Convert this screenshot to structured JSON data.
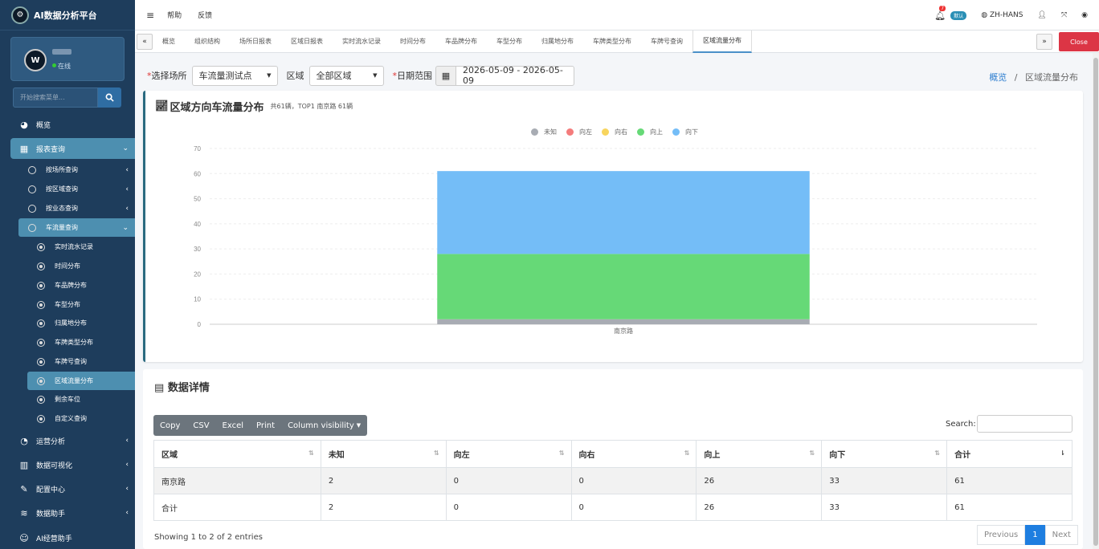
{
  "brand": {
    "title": "AI数据分析平台"
  },
  "user": {
    "status": "在线"
  },
  "sidebar_search": {
    "placeholder": "开始搜索菜单..."
  },
  "nav": {
    "overview": "概览",
    "reports": "报表查询",
    "by_venue": "按场所查询",
    "by_region": "按区域查询",
    "by_business": "按业态查询",
    "traffic": "车流量查询",
    "traffic_items": [
      "实时流水记录",
      "时间分布",
      "车品牌分布",
      "车型分布",
      "归属地分布",
      "车牌类型分布",
      "车牌号查询",
      "区域流量分布",
      "剩余车位",
      "自定义查询"
    ],
    "operations": "运营分析",
    "visualization": "数据可视化",
    "config": "配置中心",
    "assistant": "数据助手",
    "ai_assistant": "AI经营助手"
  },
  "topbar": {
    "help": "帮助",
    "feedback": "反馈",
    "notif_count": "7",
    "default_badge": "默认",
    "language": "ZH-HANS"
  },
  "tabs": [
    "概览",
    "组织结构",
    "场所日报表",
    "区域日报表",
    "实时流水记录",
    "时间分布",
    "车品牌分布",
    "车型分布",
    "归属地分布",
    "车牌类型分布",
    "车牌号查询",
    "区域流量分布"
  ],
  "close_label": "Close",
  "filters": {
    "venue_label": "选择场所",
    "venue_value": "车流量测试点",
    "region_label": "区域",
    "region_value": "全部区域",
    "date_label": "日期范围",
    "date_value": "2026-05-09 - 2026-05-09"
  },
  "breadcrumb": {
    "home": "概览",
    "sep": "/",
    "current": "区域流量分布"
  },
  "chart_header": {
    "title": "区域方向车流量分布",
    "subtitle": "共61辆，TOP1 南京路 61辆"
  },
  "chart_data": {
    "type": "bar",
    "stacked": true,
    "categories": [
      "南京路"
    ],
    "series": [
      {
        "name": "未知",
        "values": [
          2
        ],
        "color": "#a8acb3"
      },
      {
        "name": "向左",
        "values": [
          0
        ],
        "color": "#f47c7c"
      },
      {
        "name": "向右",
        "values": [
          0
        ],
        "color": "#f8d55e"
      },
      {
        "name": "向上",
        "values": [
          26
        ],
        "color": "#66d977"
      },
      {
        "name": "向下",
        "values": [
          33
        ],
        "color": "#74bdf7"
      }
    ],
    "ylim": [
      0,
      70
    ],
    "yticks": [
      0,
      10,
      20,
      30,
      40,
      50,
      60,
      70
    ],
    "legend": "top-center",
    "grid": true
  },
  "table_section": {
    "title": "数据详情",
    "buttons": [
      "Copy",
      "CSV",
      "Excel",
      "Print",
      "Column visibility"
    ],
    "search_label": "Search:",
    "columns": [
      "区域",
      "未知",
      "向左",
      "向右",
      "向上",
      "向下",
      "合计"
    ],
    "rows": [
      [
        "南京路",
        "2",
        "0",
        "0",
        "26",
        "33",
        "61"
      ],
      [
        "合计",
        "2",
        "0",
        "0",
        "26",
        "33",
        "61"
      ]
    ],
    "info": "Showing 1 to 2 of 2 entries",
    "pager": {
      "prev": "Previous",
      "page": "1",
      "next": "Next"
    }
  }
}
